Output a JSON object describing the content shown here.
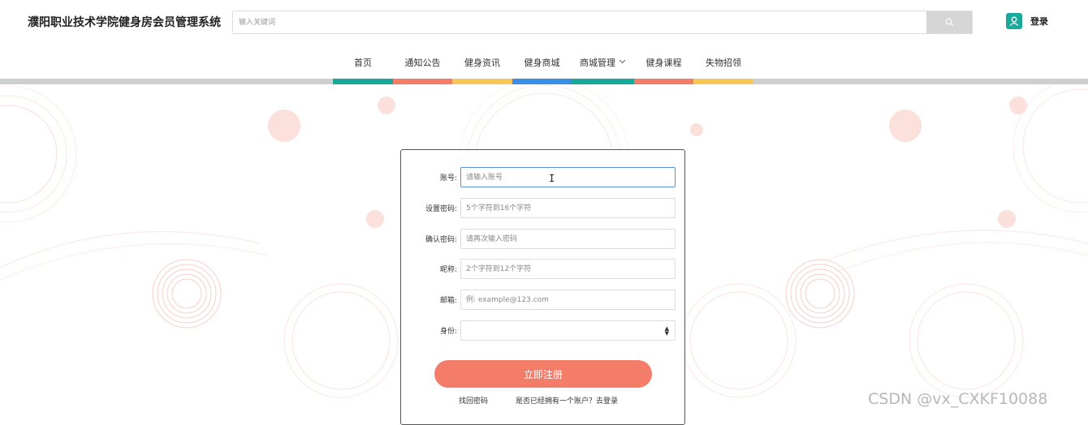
{
  "header": {
    "site_title": "濮阳职业技术学院健身房会员管理系统",
    "search_placeholder": "输入关键词",
    "login_label": "登录"
  },
  "nav": {
    "items": [
      {
        "label": "首页",
        "has_dropdown": false,
        "bar_color": "#17a89a"
      },
      {
        "label": "通知公告",
        "has_dropdown": false,
        "bar_color": "#f47d6a"
      },
      {
        "label": "健身资讯",
        "has_dropdown": false,
        "bar_color": "#f9c757"
      },
      {
        "label": "健身商城",
        "has_dropdown": false,
        "bar_color": "#3a8ee6"
      },
      {
        "label": "商城管理",
        "has_dropdown": true,
        "bar_color": "#17a89a"
      },
      {
        "label": "健身课程",
        "has_dropdown": false,
        "bar_color": "#f47d6a"
      },
      {
        "label": "失物招领",
        "has_dropdown": false,
        "bar_color": "#f9c757"
      }
    ]
  },
  "form": {
    "fields": [
      {
        "label": "账号:",
        "placeholder": "请输入账号",
        "focused": true
      },
      {
        "label": "设置密码:",
        "placeholder": "5个字符到16个字符"
      },
      {
        "label": "确认密码:",
        "placeholder": "请再次输入密码"
      },
      {
        "label": "昵称:",
        "placeholder": "2个字符到12个字符"
      },
      {
        "label": "邮箱:",
        "placeholder": "例: example@123.com"
      }
    ],
    "identity_label": "身份:",
    "identity_value": "",
    "register_label": "立即注册",
    "forgot_label": "找回密码",
    "have_account_label": "是否已经拥有一个账户？去登录"
  },
  "watermark": "CSDN @vx_CXKF10088",
  "colors": {
    "accent_teal": "#17a89a",
    "accent_coral": "#f47d6a",
    "accent_yellow": "#f9c757",
    "accent_blue": "#3a8ee6",
    "decor_pink": "#f6c6c0"
  }
}
